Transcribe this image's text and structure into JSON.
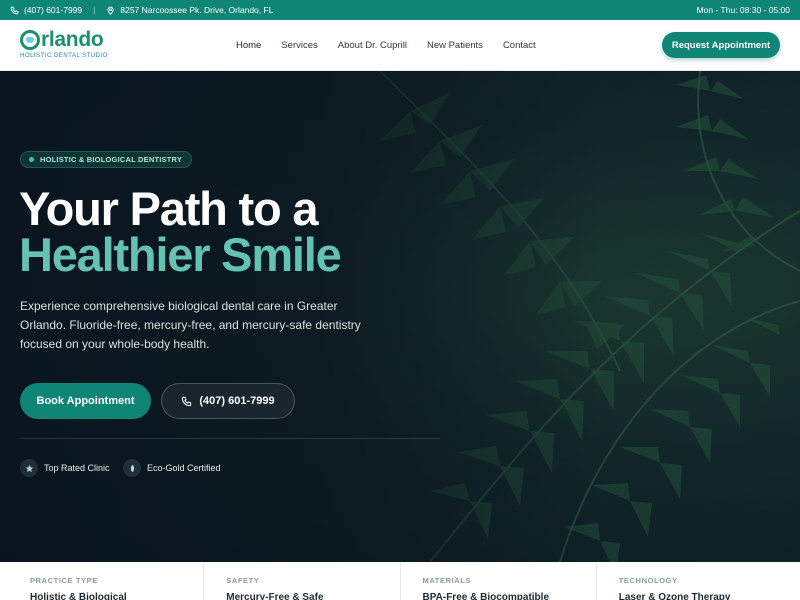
{
  "topbar": {
    "phone": "(407) 601-7999",
    "separator": "|",
    "address": "8257 Narcoossee Pk. Drive, Orlando, FL",
    "hours": "Mon - Thu: 08:30 - 05:00"
  },
  "logo": {
    "word_rest": "rlando",
    "tagline": "HOLISTIC DENTAL STUDIO"
  },
  "nav": {
    "items": [
      {
        "label": "Home"
      },
      {
        "label": "Services"
      },
      {
        "label": "About Dr. Cuprill"
      },
      {
        "label": "New Patients"
      },
      {
        "label": "Contact"
      }
    ],
    "cta": "Request Appointment"
  },
  "hero": {
    "badge": "HOLISTIC & BIOLOGICAL DENTISTRY",
    "title_line1": "Your Path to a",
    "title_line2": "Healthier Smile",
    "lede": "Experience comprehensive biological dental care in Greater Orlando. Fluoride-free, mercury-free, and mercury-safe dentistry focused on your whole-body health.",
    "primary_button": "Book Appointment",
    "phone_button": "(407) 601-7999",
    "trust": [
      {
        "label": "Top Rated Clinic"
      },
      {
        "label": "Eco-Gold Certified"
      }
    ]
  },
  "features": [
    {
      "label": "PRACTICE TYPE",
      "value": "Holistic & Biological"
    },
    {
      "label": "SAFETY",
      "value": "Mercury-Free & Safe"
    },
    {
      "label": "MATERIALS",
      "value": "BPA-Free & Biocompatible"
    },
    {
      "label": "TECHNOLOGY",
      "value": "Laser & Ozone Therapy"
    }
  ],
  "colors": {
    "brand": "#0f8576",
    "accent_text": "#64c2b3",
    "hero_dark": "#0c1a24"
  }
}
